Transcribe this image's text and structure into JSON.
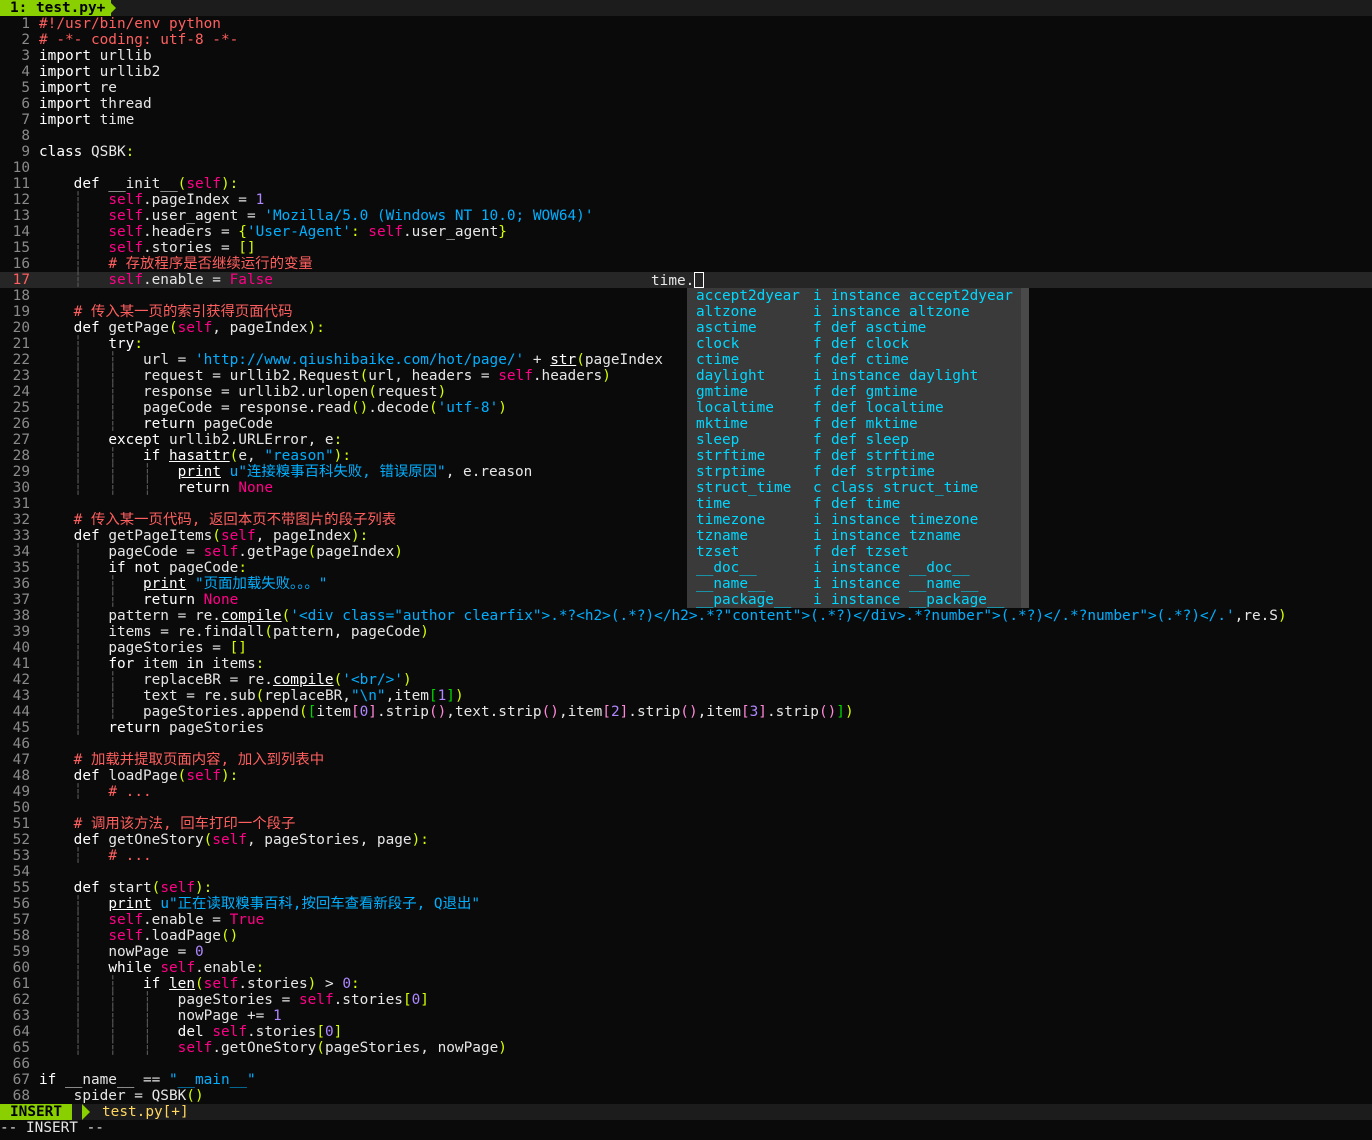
{
  "tabline": {
    "tab_label": "1: test.py+"
  },
  "statusline": {
    "mode": "INSERT",
    "filename": "test.py[+]"
  },
  "cmdline": {
    "text": "-- INSERT --"
  },
  "inline_text": "time.",
  "current_line": 17,
  "completion_menu": {
    "items": [
      {
        "word": "accept2dyear",
        "kind": "i",
        "desc": "instance accept2dyear"
      },
      {
        "word": "altzone",
        "kind": "i",
        "desc": "instance altzone"
      },
      {
        "word": "asctime",
        "kind": "f",
        "desc": "def asctime"
      },
      {
        "word": "clock",
        "kind": "f",
        "desc": "def clock"
      },
      {
        "word": "ctime",
        "kind": "f",
        "desc": "def ctime"
      },
      {
        "word": "daylight",
        "kind": "i",
        "desc": "instance daylight"
      },
      {
        "word": "gmtime",
        "kind": "f",
        "desc": "def gmtime"
      },
      {
        "word": "localtime",
        "kind": "f",
        "desc": "def localtime"
      },
      {
        "word": "mktime",
        "kind": "f",
        "desc": "def mktime"
      },
      {
        "word": "sleep",
        "kind": "f",
        "desc": "def sleep"
      },
      {
        "word": "strftime",
        "kind": "f",
        "desc": "def strftime"
      },
      {
        "word": "strptime",
        "kind": "f",
        "desc": "def strptime"
      },
      {
        "word": "struct_time",
        "kind": "c",
        "desc": "class struct_time"
      },
      {
        "word": "time",
        "kind": "f",
        "desc": "def time"
      },
      {
        "word": "timezone",
        "kind": "i",
        "desc": "instance timezone"
      },
      {
        "word": "tzname",
        "kind": "i",
        "desc": "instance tzname"
      },
      {
        "word": "tzset",
        "kind": "f",
        "desc": "def tzset"
      },
      {
        "word": "__doc__",
        "kind": "i",
        "desc": "instance __doc__"
      },
      {
        "word": "__name__",
        "kind": "i",
        "desc": "instance __name__"
      },
      {
        "word": "__package__",
        "kind": "i",
        "desc": "instance __package__"
      }
    ]
  },
  "lines": [
    {
      "n": "1",
      "code": "#!/usr/bin/env python"
    },
    {
      "n": "2",
      "code": "# -*- coding: utf-8 -*-"
    },
    {
      "n": "3",
      "code": "import urllib"
    },
    {
      "n": "4",
      "code": "import urllib2"
    },
    {
      "n": "5",
      "code": "import re"
    },
    {
      "n": "6",
      "code": "import thread"
    },
    {
      "n": "7",
      "code": "import time"
    },
    {
      "n": "8",
      "code": ""
    },
    {
      "n": "9",
      "code": "class QSBK:"
    },
    {
      "n": "10",
      "code": ""
    },
    {
      "n": "11",
      "code": "    def __init__(self):"
    },
    {
      "n": "12",
      "code": "        self.pageIndex = 1"
    },
    {
      "n": "13",
      "code": "        self.user_agent = 'Mozilla/5.0 (Windows NT 10.0; WOW64)'"
    },
    {
      "n": "14",
      "code": "        self.headers = {'User-Agent': self.user_agent}"
    },
    {
      "n": "15",
      "code": "        self.stories = []"
    },
    {
      "n": "16",
      "code": "        # 存放程序是否继续运行的变量"
    },
    {
      "n": "17",
      "code": "        self.enable = False"
    },
    {
      "n": "18",
      "code": ""
    },
    {
      "n": "19",
      "code": "    # 传入某一页的索引获得页面代码"
    },
    {
      "n": "20",
      "code": "    def getPage(self, pageIndex):"
    },
    {
      "n": "21",
      "code": "        try:"
    },
    {
      "n": "22",
      "code": "            url = 'http://www.qiushibaike.com/hot/page/' + str(pageIndex"
    },
    {
      "n": "23",
      "code": "            request = urllib2.Request(url, headers = self.headers)"
    },
    {
      "n": "24",
      "code": "            response = urllib2.urlopen(request)"
    },
    {
      "n": "25",
      "code": "            pageCode = response.read().decode('utf-8')"
    },
    {
      "n": "26",
      "code": "            return pageCode"
    },
    {
      "n": "27",
      "code": "        except urllib2.URLError, e:"
    },
    {
      "n": "28",
      "code": "            if hasattr(e, \"reason\"):"
    },
    {
      "n": "29",
      "code": "                print u\"连接糗事百科失败, 错误原因\", e.reason"
    },
    {
      "n": "30",
      "code": "                return None"
    },
    {
      "n": "31",
      "code": ""
    },
    {
      "n": "32",
      "code": "    # 传入某一页代码, 返回本页不带图片的段子列表"
    },
    {
      "n": "33",
      "code": "    def getPageItems(self, pageIndex):"
    },
    {
      "n": "34",
      "code": "        pageCode = self.getPage(pageIndex)"
    },
    {
      "n": "35",
      "code": "        if not pageCode:"
    },
    {
      "n": "36",
      "code": "            print \"页面加载失败。。。\""
    },
    {
      "n": "37",
      "code": "            return None"
    },
    {
      "n": "38",
      "code": "        pattern = re.compile('<div class=\"author clearfix\">.*?<h2>(.*?)</h2>.*?\"content\">(.*?)</div>.*?number\">(.*?)</.*?number\">(.*?)</.',re.S)"
    },
    {
      "n": "39",
      "code": "        items = re.findall(pattern, pageCode)"
    },
    {
      "n": "40",
      "code": "        pageStories = []"
    },
    {
      "n": "41",
      "code": "        for item in items:"
    },
    {
      "n": "42",
      "code": "            replaceBR = re.compile('<br/>')"
    },
    {
      "n": "43",
      "code": "            text = re.sub(replaceBR,\"\\n\",item[1])"
    },
    {
      "n": "44",
      "code": "            pageStories.append([item[0].strip(),text.strip(),item[2].strip(),item[3].strip()])"
    },
    {
      "n": "45",
      "code": "        return pageStories"
    },
    {
      "n": "46",
      "code": ""
    },
    {
      "n": "47",
      "code": "    # 加载并提取页面内容, 加入到列表中"
    },
    {
      "n": "48",
      "code": "    def loadPage(self):"
    },
    {
      "n": "49",
      "code": "        # ..."
    },
    {
      "n": "50",
      "code": ""
    },
    {
      "n": "51",
      "code": "    # 调用该方法, 回车打印一个段子"
    },
    {
      "n": "52",
      "code": "    def getOneStory(self, pageStories, page):"
    },
    {
      "n": "53",
      "code": "        # ..."
    },
    {
      "n": "54",
      "code": ""
    },
    {
      "n": "55",
      "code": "    def start(self):"
    },
    {
      "n": "56",
      "code": "        print u\"正在读取糗事百科,按回车查看新段子, Q退出\""
    },
    {
      "n": "57",
      "code": "        self.enable = True"
    },
    {
      "n": "58",
      "code": "        self.loadPage()"
    },
    {
      "n": "59",
      "code": "        nowPage = 0"
    },
    {
      "n": "60",
      "code": "        while self.enable:"
    },
    {
      "n": "61",
      "code": "            if len(self.stories) > 0:"
    },
    {
      "n": "62",
      "code": "                pageStories = self.stories[0]"
    },
    {
      "n": "63",
      "code": "                nowPage += 1"
    },
    {
      "n": "64",
      "code": "                del self.stories[0]"
    },
    {
      "n": "65",
      "code": "                self.getOneStory(pageStories, nowPage)"
    },
    {
      "n": "66",
      "code": ""
    },
    {
      "n": "67",
      "code": "if __name__ == \"__main__\""
    },
    {
      "n": "68",
      "code": "    spider = QSBK()"
    }
  ]
}
